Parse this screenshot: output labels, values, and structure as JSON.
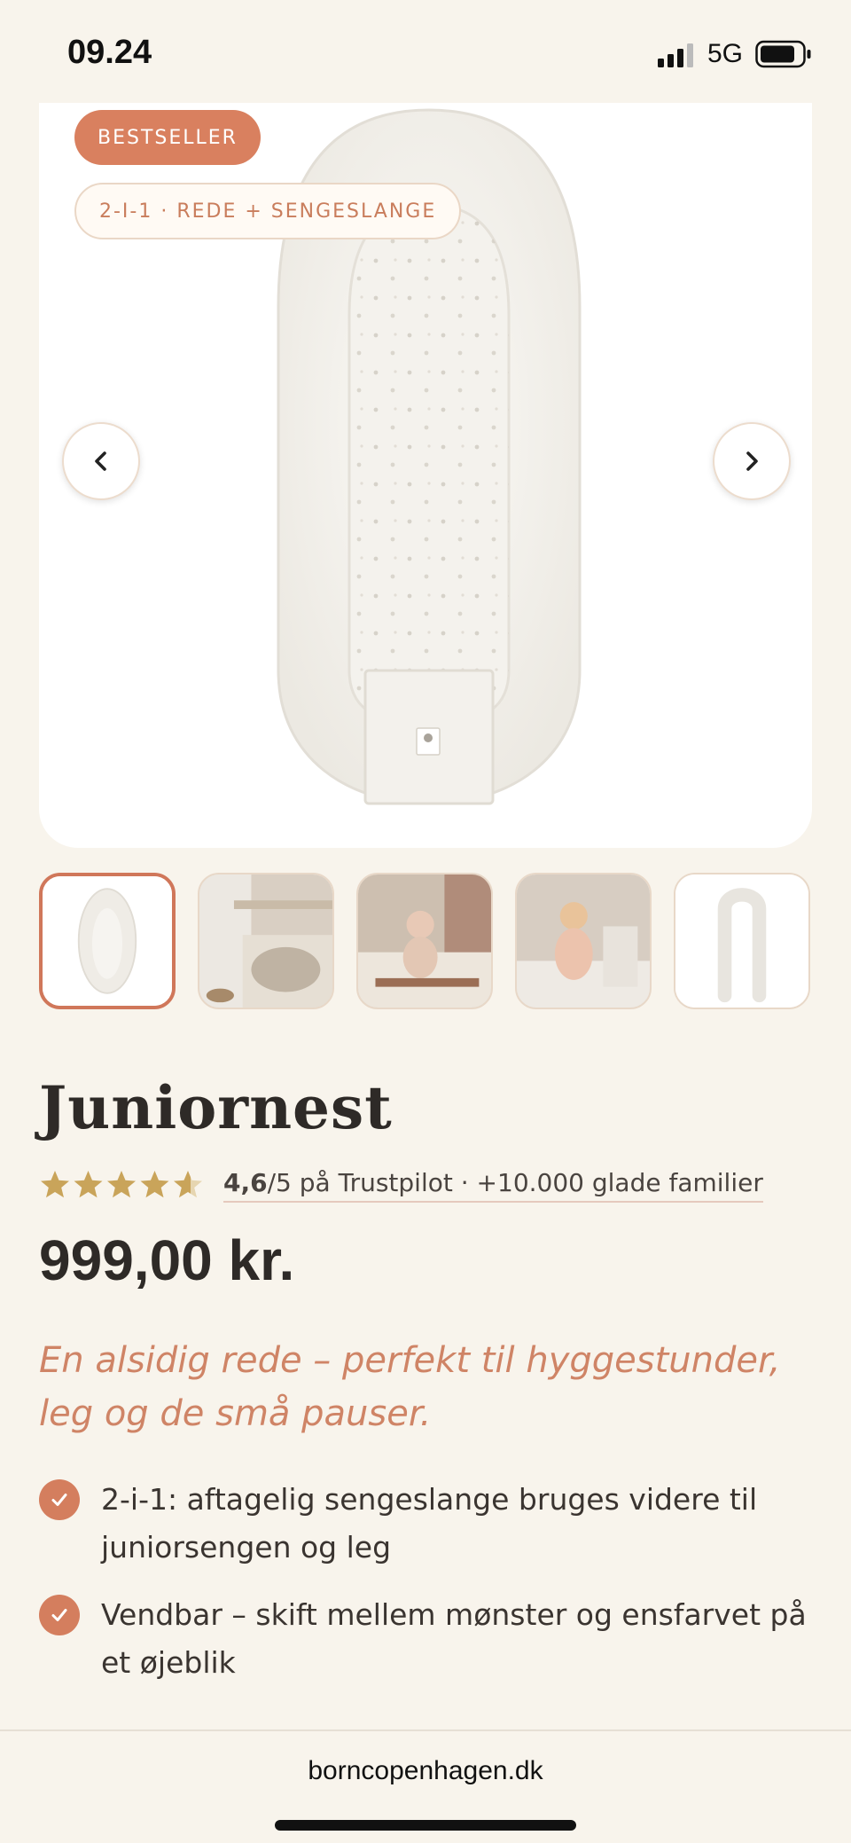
{
  "status_bar": {
    "time": "09.24",
    "network": "5G"
  },
  "gallery": {
    "badge_bestseller": "BESTSELLER",
    "badge_combo": "2-I-1 · REDE + SENGESLANGE",
    "thumbnails": [
      "nest-flat",
      "nest-in-bed",
      "child-with-toys",
      "child-sitting",
      "nest-open"
    ],
    "active_thumbnail": 0
  },
  "product": {
    "title": "Juniornest",
    "rating_score": "4,6",
    "rating_rest": "/5 på Trustpilot · +10.000 glade familier",
    "stars": 4.6,
    "price": "999,00 kr.",
    "tagline": "En alsidig rede – perfekt til hyggestunder, leg og de små pauser.",
    "features": [
      "2-i-1: aftagelig sengeslange bruges videre til juniorsengen og leg",
      "Vendbar – skift mellem mønster og ensfarvet på et øjeblik"
    ]
  },
  "browser": {
    "url": "borncopenhagen.dk"
  },
  "colors": {
    "background": "#f8f4ec",
    "accent": "#d9805f",
    "star": "#c9a45a",
    "tagline": "#cf8466"
  }
}
